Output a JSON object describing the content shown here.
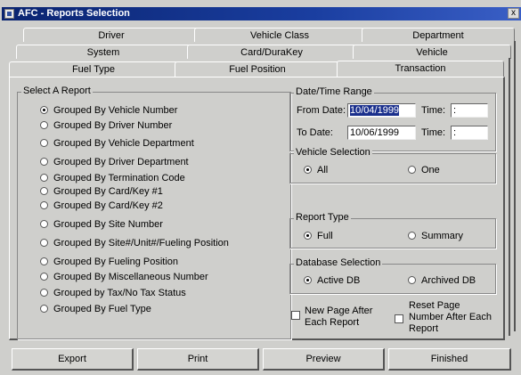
{
  "window": {
    "title": "AFC - Reports Selection",
    "close_glyph": "x"
  },
  "tabs": {
    "row1": [
      "Driver",
      "Vehicle Class",
      "Department"
    ],
    "row2": [
      "System",
      "Card/DuraKey",
      "Vehicle"
    ],
    "row3": [
      "Fuel Type",
      "Fuel Position",
      "Transaction"
    ]
  },
  "select_report": {
    "label": "Select A Report",
    "options": [
      "Grouped By Vehicle Number",
      "Grouped By Driver Number",
      "Grouped By Vehicle Department",
      "Grouped By Driver Department",
      "Grouped By Termination Code",
      "Grouped By Card/Key #1",
      "Grouped By Card/Key #2",
      "Grouped By Site Number",
      "Grouped By Site#/Unit#/Fueling Position",
      "Grouped By Fueling Position",
      "Grouped By Miscellaneous Number",
      "Grouped by Tax/No Tax Status",
      "Grouped By Fuel Type"
    ],
    "selected": "Grouped By Vehicle Number"
  },
  "date_range": {
    "label": "Date/Time Range",
    "from_label": "From Date:",
    "from_value": "10/04/1999",
    "to_label": "To Date:",
    "to_value": "10/06/1999",
    "time_label": "Time:",
    "time_value": " :"
  },
  "vehicle_selection": {
    "label": "Vehicle Selection",
    "options": [
      "All",
      "One"
    ],
    "selected": "All"
  },
  "report_type": {
    "label": "Report Type",
    "options": [
      "Full",
      "Summary"
    ],
    "selected": "Full"
  },
  "database_selection": {
    "label": "Database Selection",
    "options": [
      "Active DB",
      "Archived DB"
    ],
    "selected": "Active DB"
  },
  "checkboxes": {
    "new_page": {
      "line1": "New Page After",
      "line2": "Each Report",
      "checked": false
    },
    "reset_page": {
      "line1": "Reset Page",
      "line2": "Number After Each",
      "line3": "Report",
      "checked": false
    }
  },
  "buttons": {
    "export": "Export",
    "print": "Print",
    "preview": "Preview",
    "finished": "Finished"
  }
}
